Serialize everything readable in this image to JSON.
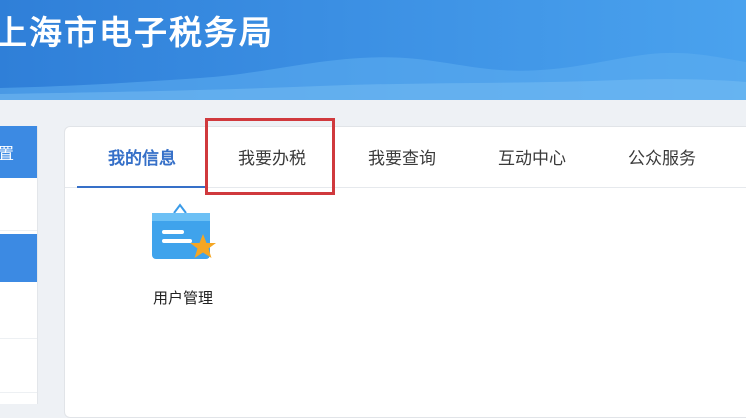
{
  "header": {
    "title": "上海市电子税务局"
  },
  "sidebar": {
    "top_label": "置"
  },
  "tabs": [
    {
      "label": "我的信息",
      "active": true
    },
    {
      "label": "我要办税",
      "active": false,
      "highlighted": true
    },
    {
      "label": "我要查询",
      "active": false
    },
    {
      "label": "互动中心",
      "active": false
    },
    {
      "label": "公众服务",
      "active": false
    }
  ],
  "content": {
    "tiles": [
      {
        "label": "用户管理",
        "icon": "user-management-icon"
      }
    ]
  },
  "colors": {
    "accent": "#3670c8",
    "header": "#3b8fe3",
    "highlight": "#d0393d",
    "star": "#f5a623"
  }
}
